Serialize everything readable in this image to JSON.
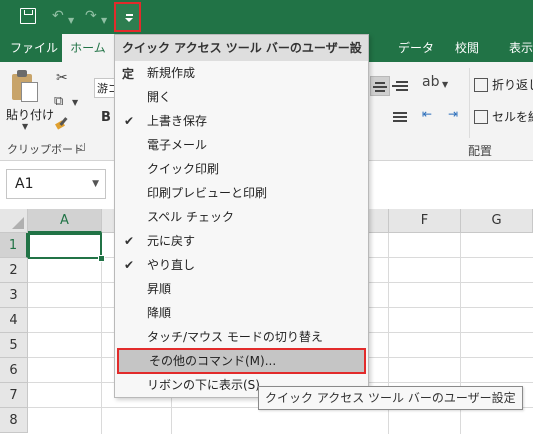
{
  "qat": {
    "save_icon": "save-icon",
    "undo_icon": "undo-icon",
    "redo_icon": "redo-icon",
    "customize_icon": "customize-qat-icon"
  },
  "tabs": {
    "file": "ファイル",
    "home": "ホーム",
    "data": "データ",
    "review": "校閲",
    "view": "表示"
  },
  "ribbon": {
    "paste_label": "貼り付け",
    "font_name": "游ゴ",
    "bold_label": "B",
    "clipboard_group": "クリップボード",
    "wrap_text": "折り返し",
    "merge_cells": "セルを結",
    "alignment_group": "配置"
  },
  "namebox": {
    "value": "A1"
  },
  "grid": {
    "columns": [
      "A",
      "F",
      "G"
    ],
    "rows": [
      "1",
      "2",
      "3",
      "4",
      "5",
      "6",
      "7",
      "8"
    ]
  },
  "menu": {
    "header": "クイック アクセス ツール バーのユーザー設定",
    "items": [
      {
        "label": "新規作成",
        "checked": false
      },
      {
        "label": "開く",
        "checked": false
      },
      {
        "label": "上書き保存",
        "checked": true
      },
      {
        "label": "電子メール",
        "checked": false
      },
      {
        "label": "クイック印刷",
        "checked": false
      },
      {
        "label": "印刷プレビューと印刷",
        "checked": false
      },
      {
        "label": "スペル チェック",
        "checked": false
      },
      {
        "label": "元に戻す",
        "checked": true
      },
      {
        "label": "やり直し",
        "checked": true
      },
      {
        "label": "昇順",
        "checked": false
      },
      {
        "label": "降順",
        "checked": false
      },
      {
        "label": "タッチ/マウス モードの切り替え",
        "checked": false
      },
      {
        "label": "その他のコマンド(M)...",
        "checked": false,
        "highlighted": true
      },
      {
        "label": "リボンの下に表示(S)",
        "checked": false
      }
    ]
  },
  "tooltip": {
    "text": "クイック アクセス ツール バーのユーザー設定"
  },
  "colors": {
    "excel_green": "#217346",
    "highlight_border": "#e22b2b"
  }
}
